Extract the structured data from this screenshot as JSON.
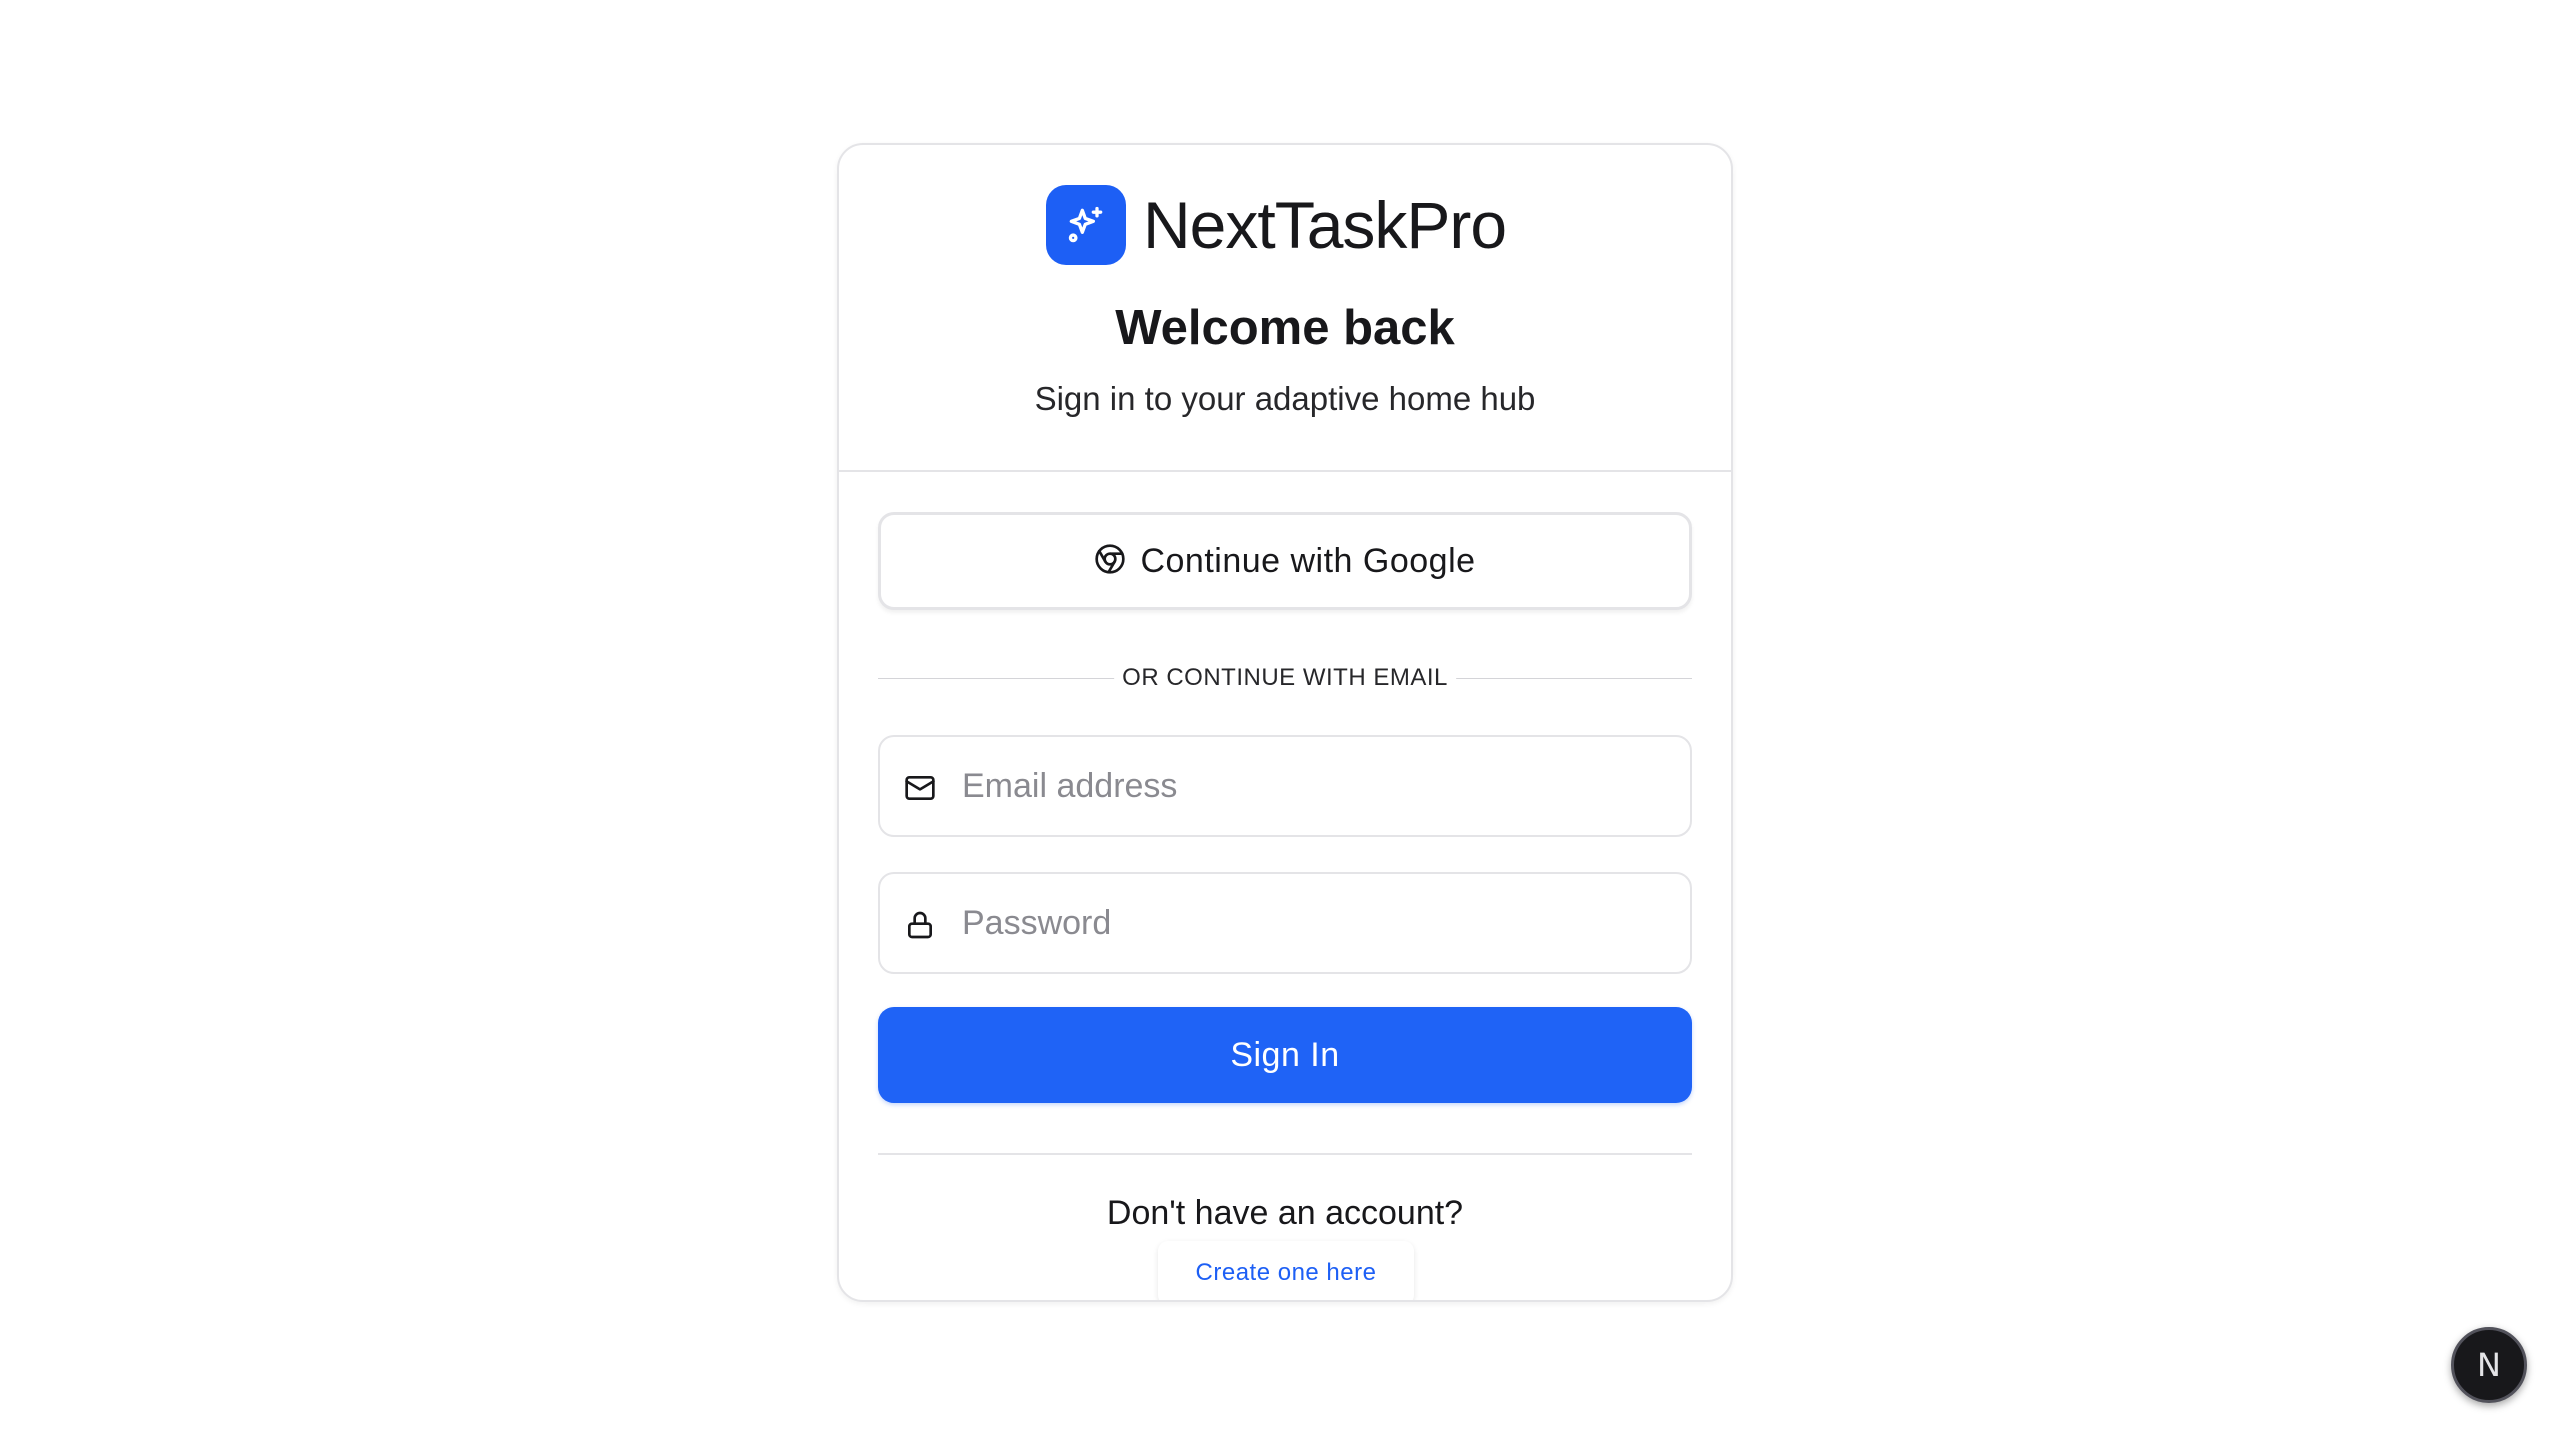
{
  "brand": {
    "name": "NextTaskPro",
    "logo_icon": "sparkles-icon",
    "logo_color": "#1d5ff5"
  },
  "header": {
    "title": "Welcome back",
    "subtitle": "Sign in to your adaptive home hub"
  },
  "google_button": {
    "label": "Continue with Google",
    "icon": "chrome-icon"
  },
  "divider": {
    "text": "OR CONTINUE WITH EMAIL"
  },
  "email_field": {
    "placeholder": "Email address",
    "value": "",
    "icon": "mail-icon"
  },
  "password_field": {
    "placeholder": "Password",
    "value": "",
    "icon": "lock-icon"
  },
  "signin_button": {
    "label": "Sign In",
    "color": "#1f63f6"
  },
  "footer": {
    "prompt": "Don't have an account?",
    "link_label": "Create one here",
    "link_color": "#1d5ff5"
  },
  "dev_badge": {
    "label": "N",
    "icon": "nextjs-icon"
  }
}
